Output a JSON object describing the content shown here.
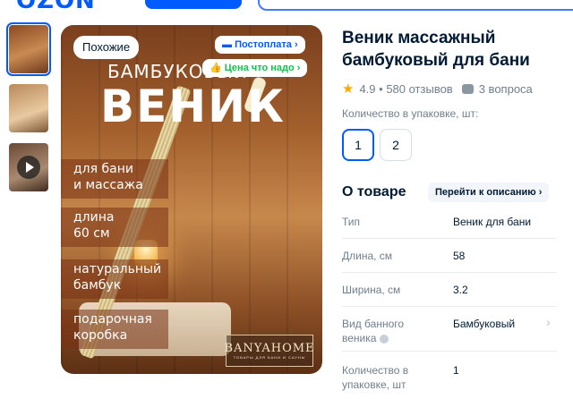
{
  "header": {
    "logo": "OZON"
  },
  "badges": {
    "similar": "Похожие",
    "postpay": "Постоплата",
    "price": "Цена что надо"
  },
  "image_text": {
    "title_top": "БАМБУКОВЫЙ",
    "title_big": "ВЕНИК",
    "features": [
      "для бани\nи массажа",
      "длина\n60 см",
      "натуральный\nбамбук",
      "подарочная\nкоробка"
    ],
    "brand": "BANYAHOME",
    "brand_sub": "ТОВАРЫ ДЛЯ БАНИ И САУНЫ"
  },
  "product": {
    "title": "Веник массажный бамбуковый для бани",
    "rating": "4.9",
    "reviews": "580 отзывов",
    "questions": "3 вопроса",
    "qty_label": "Количество в упаковке, шт:",
    "qty_options": [
      "1",
      "2"
    ],
    "qty_selected": "1"
  },
  "about": {
    "title": "О товаре",
    "goto_label": "Перейти к описанию",
    "specs": [
      {
        "name": "Тип",
        "value": "Веник для бани"
      },
      {
        "name": "Длина, см",
        "value": "58"
      },
      {
        "name": "Ширина, см",
        "value": "3.2"
      },
      {
        "name": "Вид банного веника",
        "value": "Бамбуковый"
      },
      {
        "name": "Количество в упаковке, шт",
        "value": "1"
      }
    ]
  },
  "colors": {
    "accent": "#005bff",
    "rating_star": "#ffa800",
    "price_badge": "#10c44c"
  },
  "icons": {
    "rating": "star-icon",
    "questions": "chat-icon",
    "video": "play-icon",
    "postpay": "card-icon",
    "price": "thumbs-up-icon"
  }
}
